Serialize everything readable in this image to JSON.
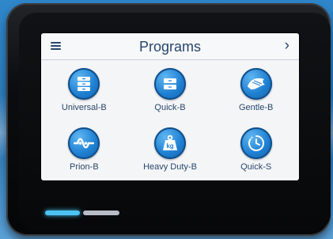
{
  "header": {
    "title": "Programs",
    "menu_icon": "hamburger-menu-icon",
    "next_icon": "chevron-right-icon",
    "next_glyph": "›"
  },
  "programs": [
    {
      "label": "Universal-B",
      "icon": "universal-program-icon"
    },
    {
      "label": "Quick-B",
      "icon": "quick-program-icon"
    },
    {
      "label": "Gentle-B",
      "icon": "gentle-program-icon"
    },
    {
      "label": "Prion-B",
      "icon": "prion-program-icon"
    },
    {
      "label": "Heavy Duty-B",
      "icon": "heavy-duty-program-icon",
      "icon_text": "kg"
    },
    {
      "label": "Quick-S",
      "icon": "quick-s-timer-icon"
    }
  ],
  "page_indicator": {
    "pages": 2,
    "current": 1
  },
  "colors": {
    "accent": "#1f7fd1",
    "text": "#27466b",
    "active_indicator": "#4cc3f3",
    "inactive_indicator": "#b7bcc6"
  }
}
